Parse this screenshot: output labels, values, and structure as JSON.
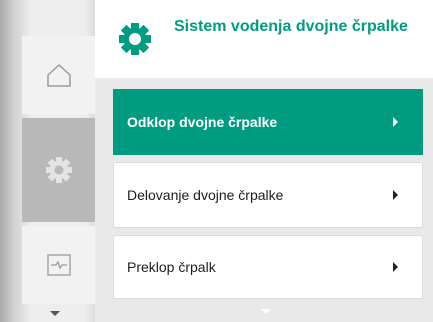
{
  "header": {
    "icon": "gear-icon",
    "title": "Sistem vodenja dvojne črpalke"
  },
  "rail": {
    "items": [
      {
        "icon": "home-icon"
      },
      {
        "icon": "gear-icon",
        "selected": true
      },
      {
        "icon": "diagnostics-icon"
      }
    ]
  },
  "menu": {
    "items": [
      {
        "label": "Odklop dvojne črpalke",
        "active": true
      },
      {
        "label": "Delovanje dvojne črpalke",
        "active": false
      },
      {
        "label": "Preklop črpalk",
        "active": false
      }
    ]
  },
  "colors": {
    "accent": "#009c82",
    "panel": "#e9e9e9",
    "rail_selected": "#b8b8b8"
  }
}
